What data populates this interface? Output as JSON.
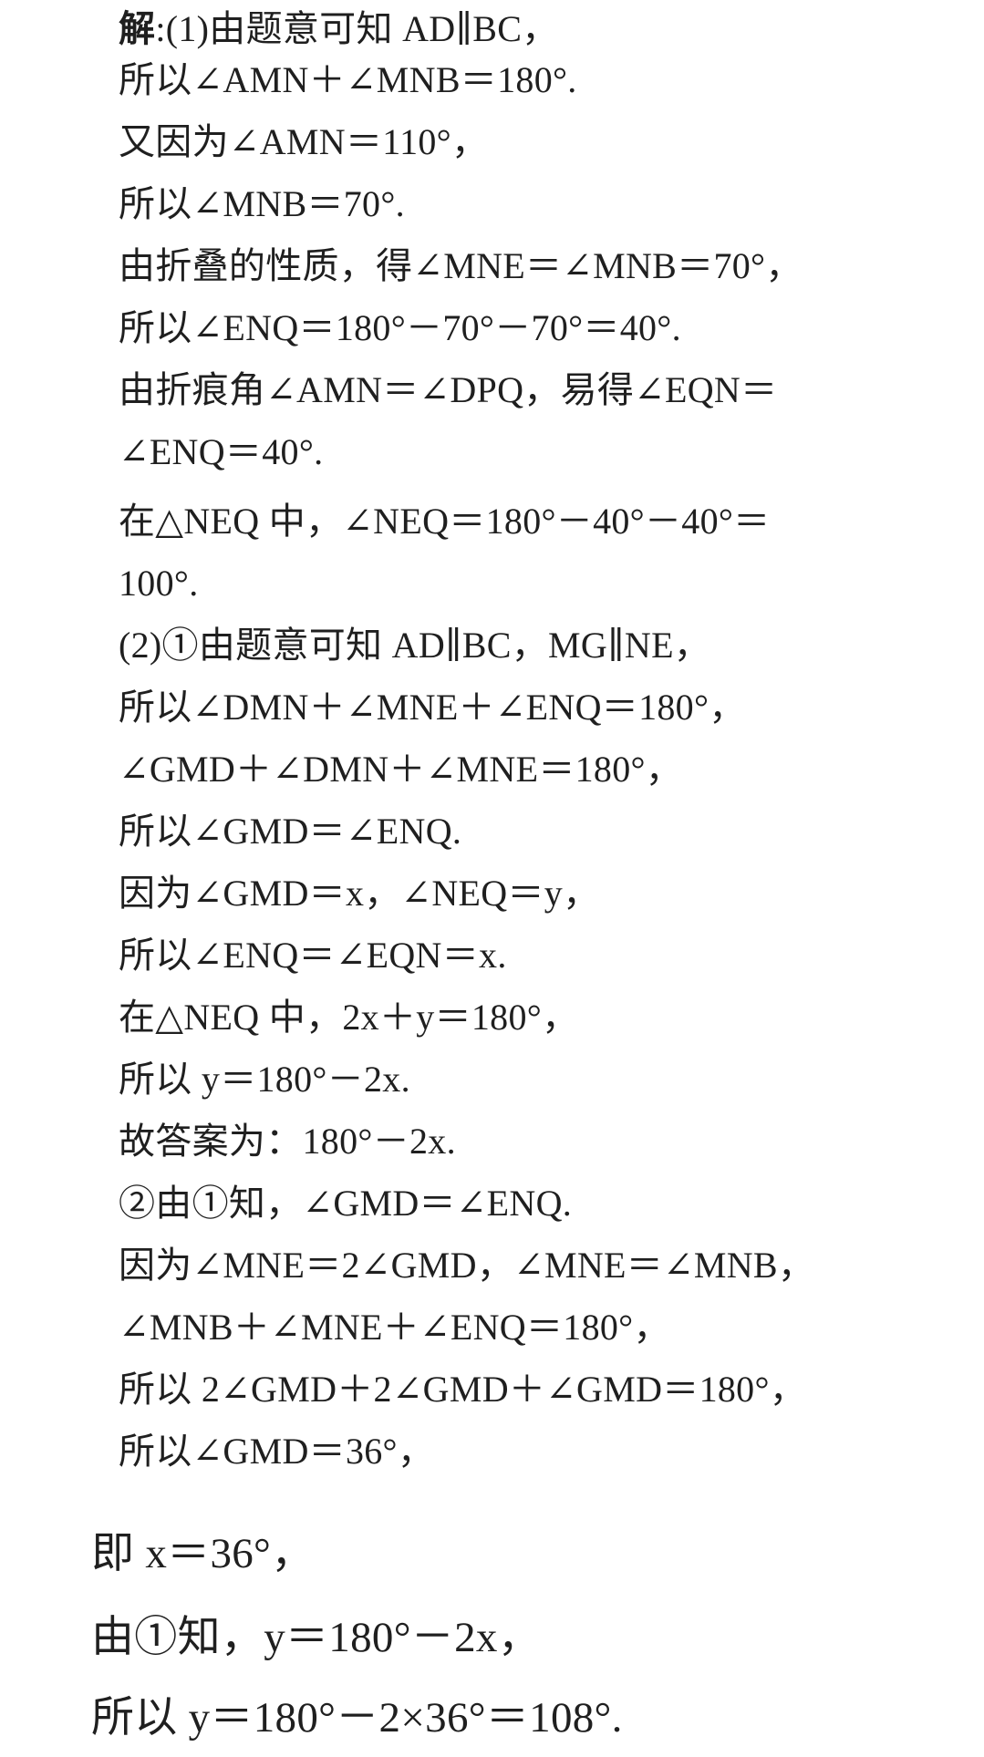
{
  "solution": {
    "lead": "解",
    "lines": [
      ":(1)由题意可知 AD∥BC，",
      "所以∠AMN＋∠MNB＝180°.",
      "又因为∠AMN＝110°，",
      "所以∠MNB＝70°.",
      "由折叠的性质，得∠MNE＝∠MNB＝70°，",
      "所以∠ENQ＝180°－70°－70°＝40°.",
      "由折痕角∠AMN＝∠DPQ，易得∠EQN＝",
      "∠ENQ＝40°.",
      "在△NEQ 中，∠NEQ＝180°－40°－40°＝",
      "100°.",
      "(2)①由题意可知 AD∥BC，MG∥NE，",
      "所以∠DMN＋∠MNE＋∠ENQ＝180°，",
      "∠GMD＋∠DMN＋∠MNE＝180°，",
      "所以∠GMD＝∠ENQ.",
      "因为∠GMD＝x，∠NEQ＝y，",
      "所以∠ENQ＝∠EQN＝x.",
      "在△NEQ 中，2x＋y＝180°，",
      "所以 y＝180°－2x.",
      "故答案为：180°－2x.",
      "②由①知，∠GMD＝∠ENQ.",
      "因为∠MNE＝2∠GMD，∠MNE＝∠MNB，",
      "∠MNB＋∠MNE＋∠ENQ＝180°，",
      "所以 2∠GMD＋2∠GMD＋∠GMD＝180°，",
      "所以∠GMD＝36°，",
      "即 x＝36°，",
      "由①知，y＝180°－2x，",
      "所以 y＝180°－2×36°＝108°."
    ]
  }
}
